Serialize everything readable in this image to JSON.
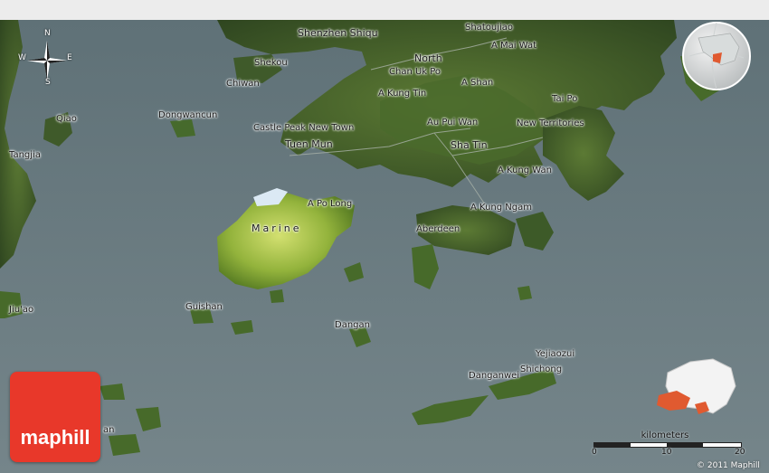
{
  "map": {
    "labels": {
      "shenzhen_shiqu": "Shenzhen Shiqu",
      "shatoujiao": "Shatoujiao",
      "a_mai_wat": "A Mai Wat",
      "shekou": "Shekou",
      "north": "North",
      "chiwan": "Chiwan",
      "chan_uk_po": "Chan Uk Po",
      "a_shan": "A Shan",
      "a_kung_tin": "A Kung Tin",
      "tai_po": "Tai Po",
      "qiao": "Qiao",
      "dongwancun": "Dongwancun",
      "au_pui_wan": "Au Pui Wan",
      "new_territories": "New Territories",
      "castle_peak": "Castle Peak New Town",
      "tuen_mun": "Tuen Mun",
      "sha_tin": "Sha Tin",
      "tangjia": "Tangjia",
      "a_kung_wan": "A Kung Wan",
      "a_po_long": "A Po Long",
      "a_kung_ngam": "A Kung Ngam",
      "marine": "Marine",
      "aberdeen": "Aberdeen",
      "jiuao": "Jiu'ao",
      "guishan": "Guishan",
      "dangan": "Dangan",
      "yejiaozui": "Yejiaozui",
      "shichong": "Shichong",
      "danganwei": "Danganwei",
      "partial_an": "an"
    },
    "compass": {
      "n": "N",
      "s": "S",
      "e": "E",
      "w": "W"
    },
    "scale": {
      "unit": "kilometers",
      "ticks": [
        "0",
        "10",
        "20"
      ]
    },
    "logo_text": "maphill",
    "copyright": "© 2011 Maphill",
    "colors": {
      "water": "#6b7a80",
      "land_dark": "#3f5a2a",
      "land_light": "#a9c64a",
      "logo": "#e8382a",
      "highlight": "#e05a30"
    }
  }
}
